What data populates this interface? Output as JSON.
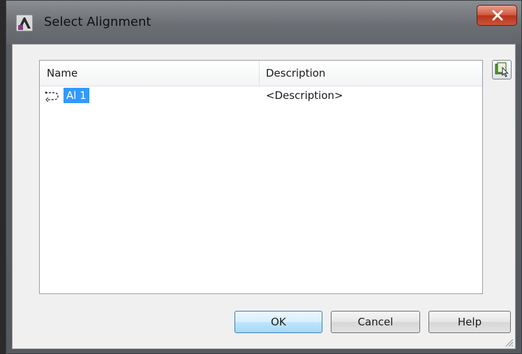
{
  "window": {
    "title": "Select Alignment",
    "app_icon": "autocad-civil3d-icon",
    "close_icon": "close-icon"
  },
  "list": {
    "columns": [
      "Name",
      "Description"
    ],
    "rows": [
      {
        "icon": "alignment-icon",
        "name": "Al 1",
        "description": "<Description>",
        "selected": true
      }
    ]
  },
  "pick_button": {
    "icon": "pick-from-drawing-icon"
  },
  "buttons": {
    "ok": "OK",
    "cancel": "Cancel",
    "help": "Help"
  },
  "colors": {
    "selection": "#3399ff",
    "close_button": "#c8553a",
    "default_button": "#bee6fd"
  }
}
